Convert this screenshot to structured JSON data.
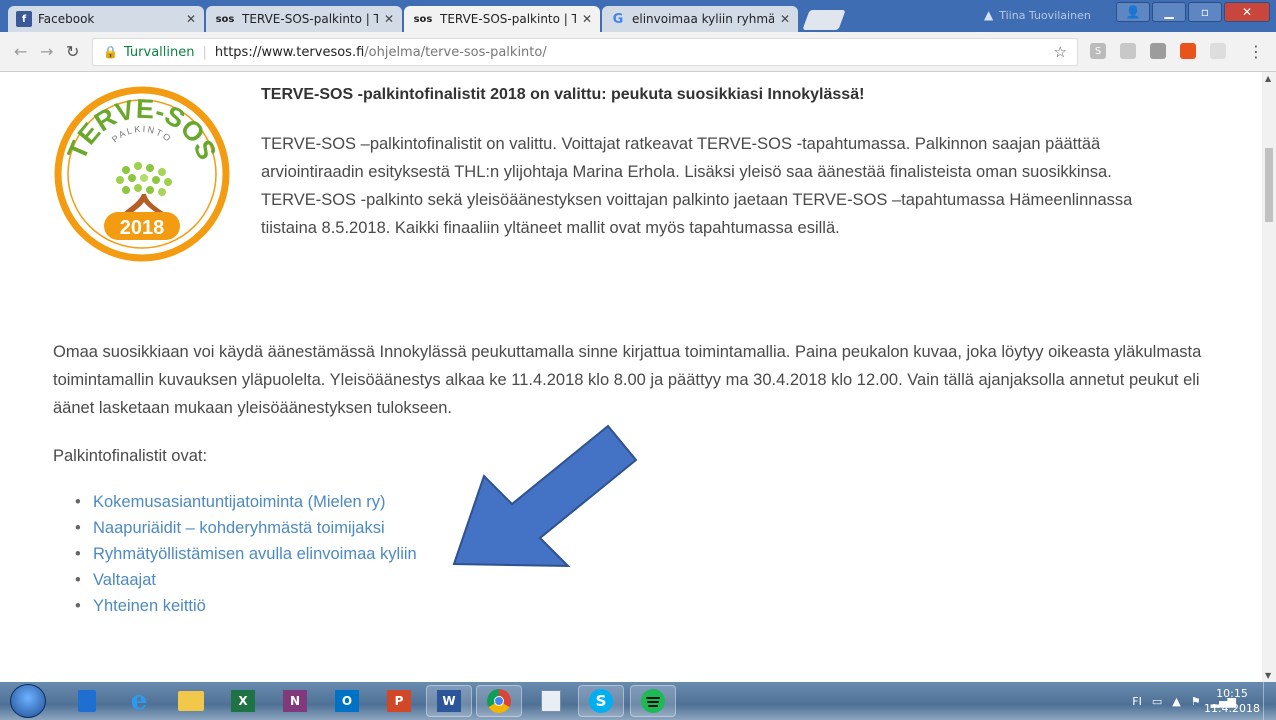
{
  "browser": {
    "tabs": [
      {
        "label": "Facebook",
        "icon": "facebook-icon",
        "active": false
      },
      {
        "label": "TERVE-SOS-palkinto | TE",
        "icon": "sos-icon",
        "active": false
      },
      {
        "label": "TERVE-SOS-palkinto | TE",
        "icon": "sos-icon",
        "active": true
      },
      {
        "label": "elinvoimaa kyliin ryhmät",
        "icon": "google-icon",
        "active": false
      }
    ],
    "tab_icon_text": {
      "sos": "sos",
      "google": "G",
      "facebook": "f"
    },
    "profile_name": "Tiina Tuovilainen",
    "security_label": "Turvallinen",
    "url_host": "https://www.tervesos.fi",
    "url_path": "/ohjelma/terve-sos-palkinto/"
  },
  "page": {
    "logo": {
      "top_text": "TERVE-SOS",
      "ribbon_text": "PALKINTO",
      "year": "2018"
    },
    "article_title": "TERVE-SOS -palkintofinalistit 2018 on valittu: peukuta suosikkiasi Innokylässä!",
    "paragraph1": "TERVE-SOS –palkintofinalistit on valittu. Voittajat ratkeavat TERVE-SOS -tapahtumassa. Palkinnon saajan päättää arviointiraadin esityksestä THL:n ylijohtaja Marina Erhola. Lisäksi yleisö saa äänestää finalisteista oman suosikkinsa. TERVE-SOS -palkinto sekä yleisöäänestyksen voittajan palkinto jaetaan TERVE-SOS –tapahtumassa Hämeenlinnassa tiistaina 8.5.2018. Kaikki finaaliin yltäneet mallit ovat myös tapahtumassa esillä.",
    "paragraph2": "Omaa suosikkiaan voi käydä äänestämässä Innokylässä peukuttamalla sinne kirjattua toimintamallia. Paina peukalon kuvaa, joka löytyy oikeasta yläkulmasta toimintamallin kuvauksen yläpuolelta. Yleisöäänestys alkaa ke 11.4.2018 klo 8.00 ja päättyy ma 30.4.2018 klo 12.00. Vain tällä ajanjaksolla annetut peukut eli äänet lasketaan mukaan yleisöäänestyksen tulokseen.",
    "finalists_label": "Palkintofinalistit ovat:",
    "finalists": [
      "Kokemusasiantuntijatoiminta (Mielen ry)",
      "Naapuriäidit – kohderyhmästä toimijaksi",
      "Ryhmätyöllistämisen avulla elinvoimaa kyliin",
      "Valtaajat",
      "Yhteinen keittiö"
    ]
  },
  "taskbar": {
    "apps": [
      {
        "name": "outlook-blue",
        "label": ""
      },
      {
        "name": "internet-explorer",
        "label": "e"
      },
      {
        "name": "file-explorer",
        "label": ""
      },
      {
        "name": "excel",
        "label": "X"
      },
      {
        "name": "onenote",
        "label": "N"
      },
      {
        "name": "outlook",
        "label": "O"
      },
      {
        "name": "powerpoint",
        "label": "P"
      },
      {
        "name": "word",
        "label": "W"
      },
      {
        "name": "chrome",
        "label": ""
      },
      {
        "name": "calculator",
        "label": ""
      },
      {
        "name": "skype",
        "label": "S"
      },
      {
        "name": "spotify",
        "label": ""
      }
    ],
    "language": "FI",
    "time": "10:15",
    "date": "11.4.2018"
  },
  "colors": {
    "link": "#4d8ac2",
    "arrow": "#4472c4",
    "logo_orange": "#f39c12",
    "logo_green": "#8cc63f"
  }
}
